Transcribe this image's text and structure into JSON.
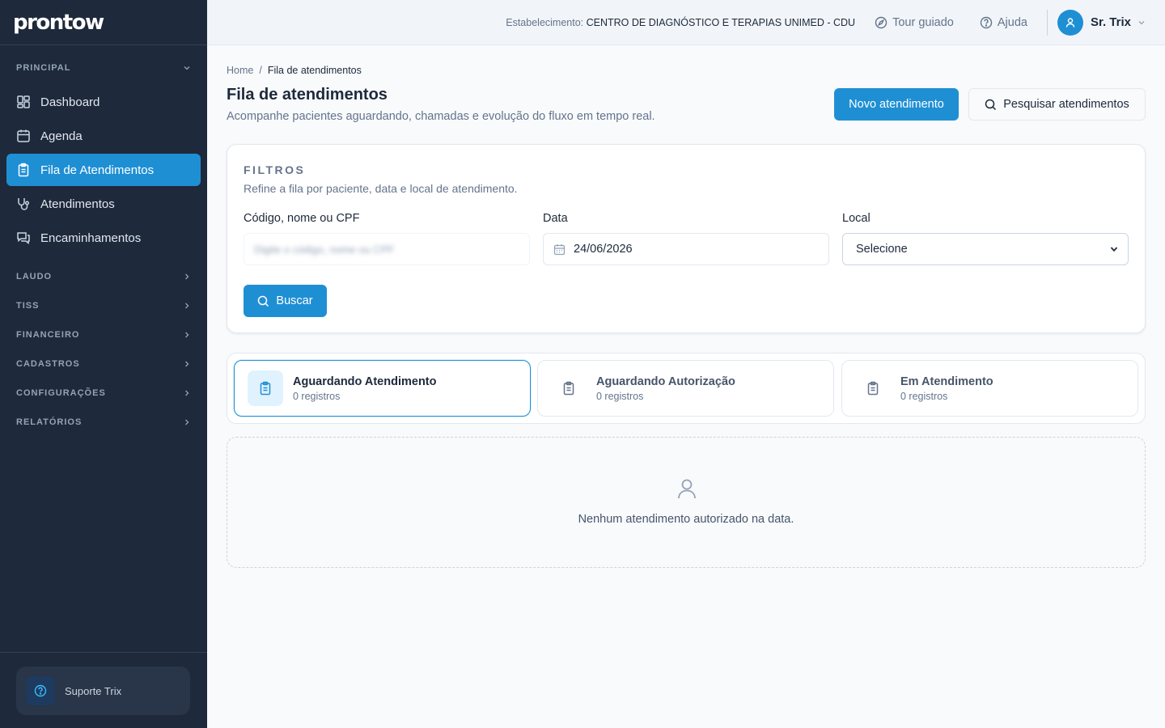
{
  "app": {
    "logo": "prontow"
  },
  "header": {
    "estab_label": "Estabelecimento:",
    "estab_name": "CENTRO DE DIAGNÓSTICO E TERAPIAS UNIMED - CDU",
    "tour": "Tour guiado",
    "help": "Ajuda",
    "user": "Sr. Trix"
  },
  "sidebar": {
    "principal": "PRINCIPAL",
    "items": [
      {
        "label": "Dashboard",
        "icon": "dashboard-icon"
      },
      {
        "label": "Agenda",
        "icon": "calendar-icon"
      },
      {
        "label": "Fila de Atendimentos",
        "icon": "clipboard-icon",
        "active": true
      },
      {
        "label": "Atendimentos",
        "icon": "stethoscope-icon"
      },
      {
        "label": "Encaminhamentos",
        "icon": "chat-icon"
      }
    ],
    "sections": [
      "LAUDO",
      "TISS",
      "FINANCEIRO",
      "CADASTROS",
      "CONFIGURAÇÕES",
      "RELATÓRIOS"
    ],
    "support": "Suporte Trix"
  },
  "page": {
    "breadcrumb": {
      "home": "Home",
      "sep": "/",
      "current": "Fila de atendimentos"
    },
    "title": "Fila de atendimentos",
    "subtitle": "Acompanhe pacientes aguardando, chamadas e evolução do fluxo em tempo real.",
    "new_button": "Novo atendimento",
    "search_button": "Pesquisar atendimentos"
  },
  "filters": {
    "heading": "FILTROS",
    "description": "Refine a fila por paciente, data e local de atendimento.",
    "code_label": "Código, nome ou CPF",
    "code_placeholder": "Digite o código, nome ou CPF",
    "date_label": "Data",
    "date_value": "24/06/2026",
    "local_label": "Local",
    "local_value": "Selecione",
    "search": "Buscar"
  },
  "tabs": [
    {
      "title": "Aguardando Atendimento",
      "count": "0 registros",
      "active": true
    },
    {
      "title": "Aguardando Autorização",
      "count": "0 registros"
    },
    {
      "title": "Em Atendimento",
      "count": "0 registros"
    }
  ],
  "empty": {
    "message": "Nenhum atendimento autorizado na data."
  },
  "colors": {
    "accent": "#1f8fd4",
    "sidebar_bg": "#1e293b",
    "page_bg": "#f8fafc"
  }
}
